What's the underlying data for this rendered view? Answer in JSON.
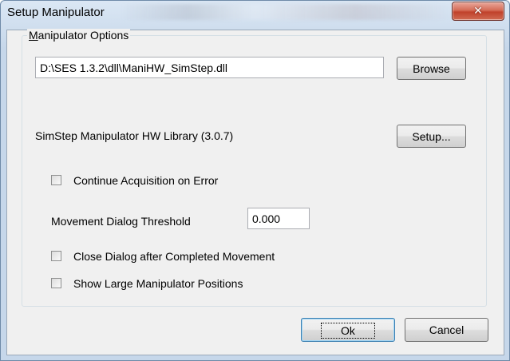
{
  "window": {
    "title": "Setup Manipulator",
    "close_glyph": "✕"
  },
  "group": {
    "label_mnemonic": "M",
    "label_rest": "anipulator Options"
  },
  "library": {
    "path_value": "D:\\SES 1.3.2\\dll\\ManiHW_SimStep.dll",
    "browse_label": "Browse",
    "info": "SimStep Manipulator HW Library (3.0.7)",
    "setup_label": "Setup..."
  },
  "options": {
    "continue_on_error": {
      "label": "Continue Acquisition on Error",
      "checked": false
    },
    "threshold_label": "Movement Dialog Threshold",
    "threshold_value": "0.000",
    "close_after_move": {
      "label": "Close Dialog after Completed Movement",
      "checked": false
    },
    "show_large_positions": {
      "label": "Show Large Manipulator Positions",
      "checked": false
    }
  },
  "footer": {
    "ok_label": "Ok",
    "cancel_label": "Cancel"
  }
}
